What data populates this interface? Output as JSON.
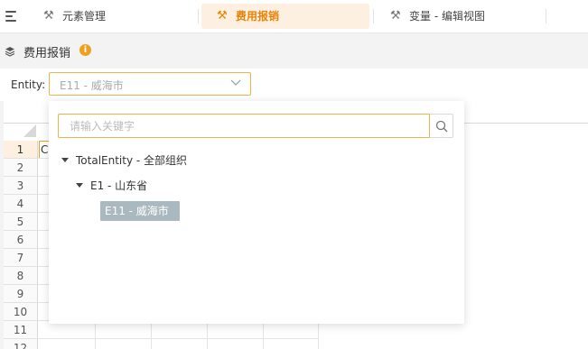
{
  "tabs": [
    {
      "label": "元素管理",
      "icon": "element-management-icon"
    },
    {
      "label": "费用报销",
      "icon": "expense-icon"
    },
    {
      "label": "变量 - 编辑视图",
      "icon": "variable-icon"
    }
  ],
  "page": {
    "title": "费用报销",
    "info_badge": "i"
  },
  "filter": {
    "entity_label": "Entity:",
    "entity_value": "E11 - 威海市"
  },
  "dropdown": {
    "search_placeholder": "请输入关键字",
    "tree": [
      {
        "label": "TotalEntity - 全部组织",
        "level": 0,
        "expanded": true
      },
      {
        "label": "E1 - 山东省",
        "level": 1,
        "expanded": true
      },
      {
        "label": "E11 - 威海市",
        "level": 2,
        "selected": true
      }
    ]
  },
  "sheet": {
    "active_cell_text": "C",
    "row_numbers": [
      "1",
      "2",
      "3",
      "4",
      "5",
      "6",
      "7",
      "8",
      "9",
      "10",
      "11",
      "12"
    ]
  },
  "colors": {
    "accent": "#e8830a",
    "accent_bg": "#fdf0e0",
    "selected_node": "#aab8c0"
  }
}
